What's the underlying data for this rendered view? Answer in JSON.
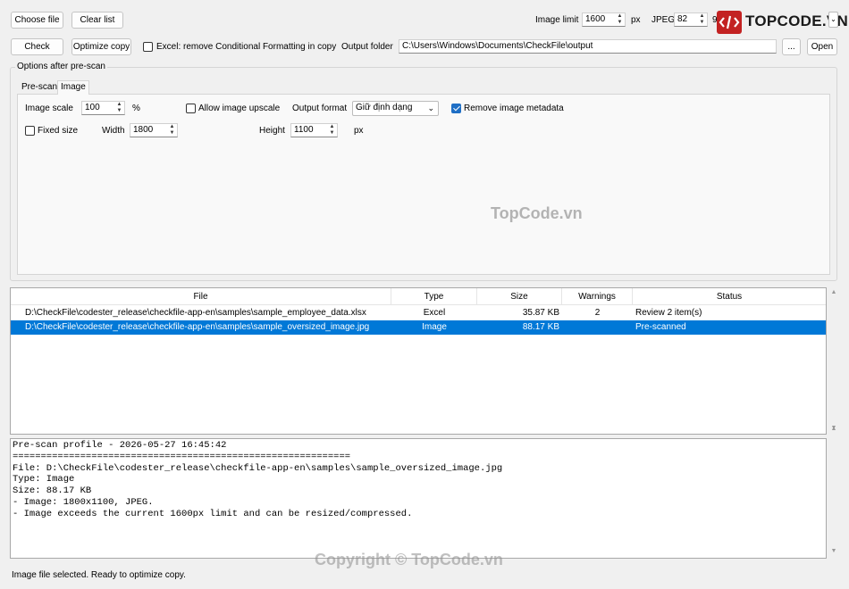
{
  "toolbar": {
    "choose_file": "Choose file",
    "clear_list": "Clear list",
    "check": "Check",
    "optimize_copy": "Optimize copy",
    "excel_remove_cf": "Excel: remove Conditional Formatting in copy",
    "excel_remove_cf_checked": false,
    "output_folder_label": "Output folder",
    "output_folder_value": "C:\\Users\\Windows\\Documents\\CheckFile\\output",
    "browse": "...",
    "open": "Open",
    "image_limit_label": "Image limit",
    "image_limit_value": "1600",
    "image_limit_unit": "px",
    "jpeg_label": "JPEG",
    "jpeg_value": "82",
    "jpeg_unit_partial": "9"
  },
  "options": {
    "group_title": "Options after pre-scan",
    "tabs": [
      {
        "label": "Pre-scan",
        "active": false
      },
      {
        "label": "Image",
        "active": true
      }
    ],
    "image_scale_label": "Image scale",
    "image_scale_value": "100",
    "image_scale_unit": "%",
    "allow_upscale_label": "Allow image upscale",
    "allow_upscale_checked": false,
    "output_format_label": "Output format",
    "output_format_value": "Giữ định dạng",
    "remove_metadata_label": "Remove image metadata",
    "remove_metadata_checked": true,
    "fixed_size_label": "Fixed size",
    "fixed_size_checked": false,
    "width_label": "Width",
    "width_value": "1800",
    "height_label": "Height",
    "height_value": "1100",
    "size_unit": "px"
  },
  "table": {
    "columns": [
      "File",
      "Type",
      "Size",
      "Warnings",
      "Status"
    ],
    "rows": [
      {
        "file": "D:\\CheckFile\\codester_release\\checkfile-app-en\\samples\\sample_employee_data.xlsx",
        "type": "Excel",
        "size": "35.87 KB",
        "warnings": "2",
        "status": "Review 2 item(s)",
        "selected": false
      },
      {
        "file": "D:\\CheckFile\\codester_release\\checkfile-app-en\\samples\\sample_oversized_image.jpg",
        "type": "Image",
        "size": "88.17 KB",
        "warnings": "",
        "status": "Pre-scanned",
        "selected": true
      }
    ]
  },
  "log": {
    "lines": [
      "Pre-scan profile - 2026-05-27 16:45:42",
      "============================================================",
      "",
      "File: D:\\CheckFile\\codester_release\\checkfile-app-en\\samples\\sample_oversized_image.jpg",
      "Type: Image",
      "Size: 88.17 KB",
      "- Image: 1800x1100, JPEG.",
      "- Image exceeds the current 1600px limit and can be resized/compressed."
    ]
  },
  "status_bar": "Image file selected. Ready to optimize copy.",
  "branding": {
    "logo_text": "TOPCODE.VN",
    "watermark_center": "TopCode.vn",
    "watermark_bottom": "Copyright © TopCode.vn"
  },
  "colors": {
    "selection": "#0078d7",
    "checkbox_checked": "#1f6fc5",
    "logo_red": "#c32222"
  }
}
